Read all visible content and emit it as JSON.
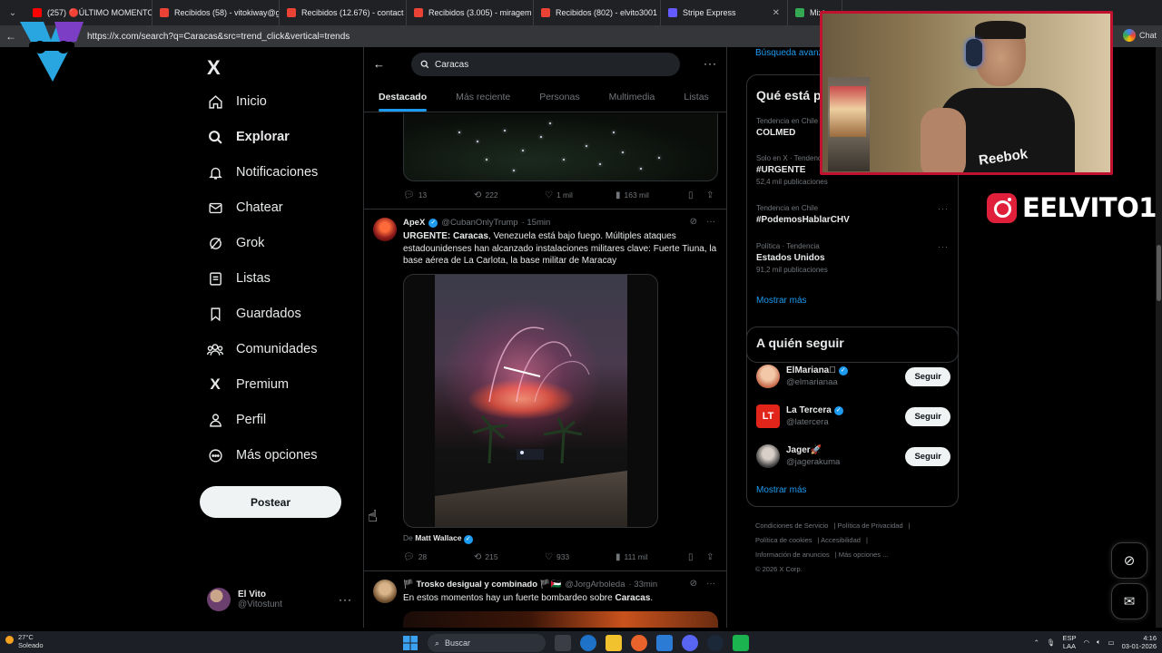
{
  "browser": {
    "tabs": [
      {
        "label": "(257) 🔴ÚLTIMO MOMENTO",
        "color": "#ff0000"
      },
      {
        "label": "Recibidos (58) - vitokiway@g",
        "color": "#ea4335"
      },
      {
        "label": "Recibidos (12.676) - contact",
        "color": "#ea4335"
      },
      {
        "label": "Recibidos (3.005) - miragem",
        "color": "#ea4335"
      },
      {
        "label": "Recibidos (802) - elvito3001",
        "color": "#ea4335"
      },
      {
        "label": "Stripe Express",
        "color": "#635bff"
      },
      {
        "label": "Mixto",
        "color": "#34a853"
      }
    ],
    "url": "https://x.com/search?q=Caracas&src=trend_click&vertical=trends",
    "right_label": "Chat"
  },
  "sidebar": {
    "logo": "X",
    "items": [
      {
        "label": "Inicio",
        "icon": "home-icon"
      },
      {
        "label": "Explorar",
        "icon": "search-icon"
      },
      {
        "label": "Notificaciones",
        "icon": "bell-icon"
      },
      {
        "label": "Chatear",
        "icon": "mail-icon"
      },
      {
        "label": "Grok",
        "icon": "grok-icon"
      },
      {
        "label": "Listas",
        "icon": "list-icon"
      },
      {
        "label": "Guardados",
        "icon": "bookmark-icon"
      },
      {
        "label": "Comunidades",
        "icon": "people-icon"
      },
      {
        "label": "Premium",
        "icon": "x-icon"
      },
      {
        "label": "Perfil",
        "icon": "user-icon"
      },
      {
        "label": "Más opciones",
        "icon": "more-circle-icon"
      }
    ],
    "post_label": "Postear",
    "profile": {
      "name": "El Vito",
      "handle": "@Vitostunt"
    }
  },
  "main": {
    "search_value": "Caracas",
    "tabs": [
      "Destacado",
      "Más reciente",
      "Personas",
      "Multimedia",
      "Listas"
    ],
    "tweet1": {
      "replies": "13",
      "reposts": "222",
      "likes": "1 mil",
      "views": "163 mil"
    },
    "tweet2": {
      "name": "ApeX",
      "handle": "@CubanOnlyTrump",
      "time": "· 15min",
      "text_pre": "URGENTE: ",
      "text_bold": "Caracas",
      "text_post": ", Venezuela está bajo fuego. Múltiples ataques estadounidenses han alcanzado instalaciones militares clave: Fuerte Tiuna, la base aérea de La Carlota, la base militar de Maracay",
      "by_prefix": "De",
      "by_name": "Matt Wallace",
      "replies": "28",
      "reposts": "215",
      "likes": "933",
      "views": "111 mil"
    },
    "tweet3": {
      "name": "🏴 Trosko desigual y combinado 🏴🇵🇸",
      "handle": "@JorgArboleda",
      "time": "· 33min",
      "text_pre": "En estos momentos hay un fuerte bombardeo sobre ",
      "text_bold": "Caracas",
      "text_post": "."
    }
  },
  "right": {
    "advanced_search": "Búsqueda avanzada",
    "trends_title": "Qué está pasando",
    "trends": [
      {
        "context": "Tendencia en Chile",
        "title": "COLMED",
        "count": ""
      },
      {
        "context": "Solo en X · Tendencia",
        "title": "#URGENTE",
        "count": "52,4 mil publicaciones"
      },
      {
        "context": "Tendencia en Chile",
        "title": "#PodemosHablarCHV",
        "count": ""
      },
      {
        "context": "Política · Tendencia",
        "title": "Estados Unidos",
        "count": "91,2 mil publicaciones"
      }
    ],
    "show_more": "Mostrar más",
    "follow_title": "A quién seguir",
    "follows": [
      {
        "name": "ElMariana🏻",
        "handle": "@elmarianaa",
        "button": "Seguir"
      },
      {
        "name": "La Tercera",
        "handle": "@latercera",
        "button": "Seguir"
      },
      {
        "name": "Jager🚀",
        "handle": "@jagerakuma",
        "button": "Seguir"
      }
    ],
    "follow_more": "Mostrar más",
    "footer": [
      "Condiciones de Servicio",
      "Política de Privacidad",
      "Política de cookies",
      "Accesibilidad",
      "Información de anuncios",
      "Más opciones ...",
      "© 2026 X Corp."
    ]
  },
  "overlay": {
    "webcam_brand": "Reebok",
    "instagram_name": "EELVITO1"
  },
  "taskbar": {
    "temp": "27°C",
    "weather": "Soleado",
    "search_placeholder": "Buscar",
    "lang1": "ESP",
    "lang2": "LAA",
    "time": "4:16",
    "date": "03-01-2026"
  },
  "colors": {
    "accent": "#1d9bf0",
    "webcam_border": "#c0122f",
    "instagram": "#e0203a"
  }
}
